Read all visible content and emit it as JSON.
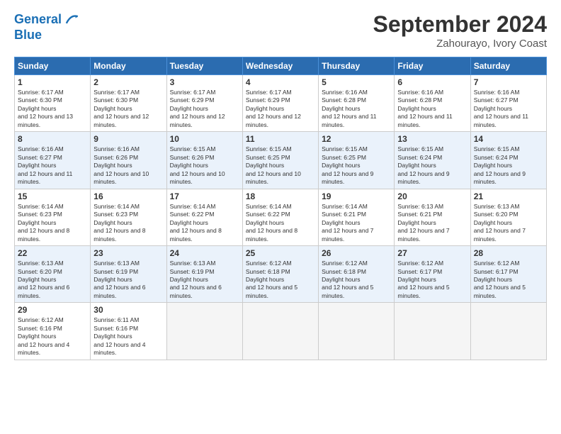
{
  "header": {
    "logo_line1": "General",
    "logo_line2": "Blue",
    "month_title": "September 2024",
    "location": "Zahourayo, Ivory Coast"
  },
  "days_of_week": [
    "Sunday",
    "Monday",
    "Tuesday",
    "Wednesday",
    "Thursday",
    "Friday",
    "Saturday"
  ],
  "weeks": [
    [
      {
        "num": "1",
        "rise": "6:17 AM",
        "set": "6:30 PM",
        "daylight": "12 hours and 13 minutes."
      },
      {
        "num": "2",
        "rise": "6:17 AM",
        "set": "6:30 PM",
        "daylight": "12 hours and 12 minutes."
      },
      {
        "num": "3",
        "rise": "6:17 AM",
        "set": "6:29 PM",
        "daylight": "12 hours and 12 minutes."
      },
      {
        "num": "4",
        "rise": "6:17 AM",
        "set": "6:29 PM",
        "daylight": "12 hours and 12 minutes."
      },
      {
        "num": "5",
        "rise": "6:16 AM",
        "set": "6:28 PM",
        "daylight": "12 hours and 11 minutes."
      },
      {
        "num": "6",
        "rise": "6:16 AM",
        "set": "6:28 PM",
        "daylight": "12 hours and 11 minutes."
      },
      {
        "num": "7",
        "rise": "6:16 AM",
        "set": "6:27 PM",
        "daylight": "12 hours and 11 minutes."
      }
    ],
    [
      {
        "num": "8",
        "rise": "6:16 AM",
        "set": "6:27 PM",
        "daylight": "12 hours and 11 minutes."
      },
      {
        "num": "9",
        "rise": "6:16 AM",
        "set": "6:26 PM",
        "daylight": "12 hours and 10 minutes."
      },
      {
        "num": "10",
        "rise": "6:15 AM",
        "set": "6:26 PM",
        "daylight": "12 hours and 10 minutes."
      },
      {
        "num": "11",
        "rise": "6:15 AM",
        "set": "6:25 PM",
        "daylight": "12 hours and 10 minutes."
      },
      {
        "num": "12",
        "rise": "6:15 AM",
        "set": "6:25 PM",
        "daylight": "12 hours and 9 minutes."
      },
      {
        "num": "13",
        "rise": "6:15 AM",
        "set": "6:24 PM",
        "daylight": "12 hours and 9 minutes."
      },
      {
        "num": "14",
        "rise": "6:15 AM",
        "set": "6:24 PM",
        "daylight": "12 hours and 9 minutes."
      }
    ],
    [
      {
        "num": "15",
        "rise": "6:14 AM",
        "set": "6:23 PM",
        "daylight": "12 hours and 8 minutes."
      },
      {
        "num": "16",
        "rise": "6:14 AM",
        "set": "6:23 PM",
        "daylight": "12 hours and 8 minutes."
      },
      {
        "num": "17",
        "rise": "6:14 AM",
        "set": "6:22 PM",
        "daylight": "12 hours and 8 minutes."
      },
      {
        "num": "18",
        "rise": "6:14 AM",
        "set": "6:22 PM",
        "daylight": "12 hours and 8 minutes."
      },
      {
        "num": "19",
        "rise": "6:14 AM",
        "set": "6:21 PM",
        "daylight": "12 hours and 7 minutes."
      },
      {
        "num": "20",
        "rise": "6:13 AM",
        "set": "6:21 PM",
        "daylight": "12 hours and 7 minutes."
      },
      {
        "num": "21",
        "rise": "6:13 AM",
        "set": "6:20 PM",
        "daylight": "12 hours and 7 minutes."
      }
    ],
    [
      {
        "num": "22",
        "rise": "6:13 AM",
        "set": "6:20 PM",
        "daylight": "12 hours and 6 minutes."
      },
      {
        "num": "23",
        "rise": "6:13 AM",
        "set": "6:19 PM",
        "daylight": "12 hours and 6 minutes."
      },
      {
        "num": "24",
        "rise": "6:13 AM",
        "set": "6:19 PM",
        "daylight": "12 hours and 6 minutes."
      },
      {
        "num": "25",
        "rise": "6:12 AM",
        "set": "6:18 PM",
        "daylight": "12 hours and 5 minutes."
      },
      {
        "num": "26",
        "rise": "6:12 AM",
        "set": "6:18 PM",
        "daylight": "12 hours and 5 minutes."
      },
      {
        "num": "27",
        "rise": "6:12 AM",
        "set": "6:17 PM",
        "daylight": "12 hours and 5 minutes."
      },
      {
        "num": "28",
        "rise": "6:12 AM",
        "set": "6:17 PM",
        "daylight": "12 hours and 5 minutes."
      }
    ],
    [
      {
        "num": "29",
        "rise": "6:12 AM",
        "set": "6:16 PM",
        "daylight": "12 hours and 4 minutes."
      },
      {
        "num": "30",
        "rise": "6:11 AM",
        "set": "6:16 PM",
        "daylight": "12 hours and 4 minutes."
      },
      null,
      null,
      null,
      null,
      null
    ]
  ]
}
